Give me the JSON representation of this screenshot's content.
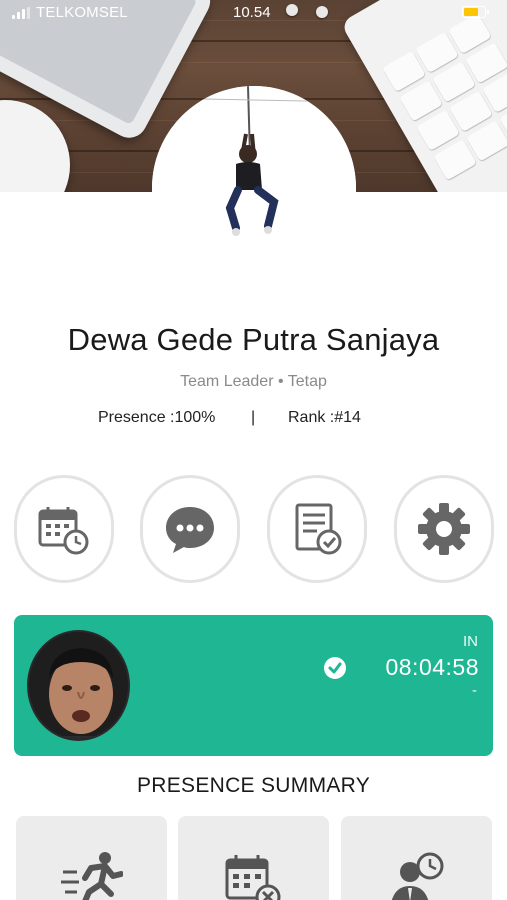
{
  "status_bar": {
    "carrier": "TELKOMSEL",
    "time": "10.54",
    "battery_percent": "",
    "battery_level": 0.7,
    "battery_color": "#ffc400"
  },
  "profile": {
    "name": "Dewa Gede Putra Sanjaya",
    "role": "Team Leader • Tetap",
    "presence": "Presence :100%",
    "divider": "|",
    "rank": "Rank :#14"
  },
  "actions": [
    {
      "icon": "calendar-clock-icon"
    },
    {
      "icon": "chat-bubble-icon"
    },
    {
      "icon": "checklist-document-icon"
    },
    {
      "icon": "gear-icon"
    }
  ],
  "attendance": {
    "direction": "IN",
    "time": "08:04:58",
    "sub": "-",
    "accent_color": "#1fb694"
  },
  "summary": {
    "title": "PRESENCE SUMMARY",
    "tiles": [
      {
        "icon": "running-person-icon"
      },
      {
        "icon": "calendar-cancel-icon"
      },
      {
        "icon": "person-clock-icon"
      }
    ]
  }
}
